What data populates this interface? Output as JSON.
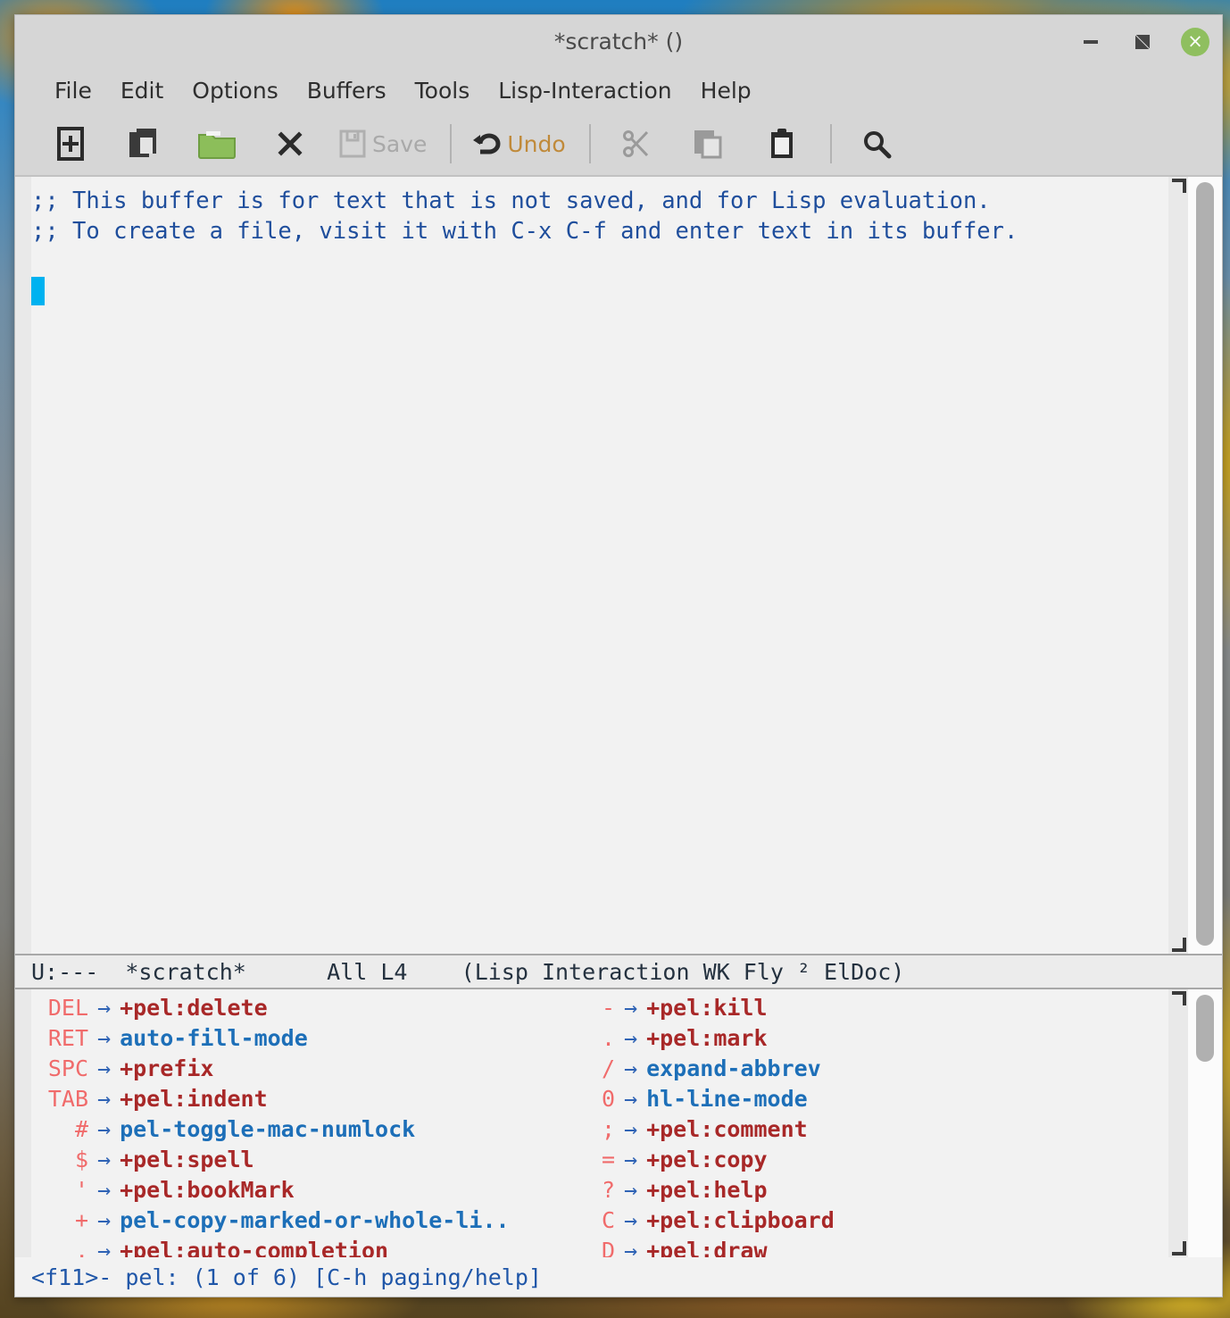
{
  "window": {
    "title": "*scratch* ()",
    "controls": {
      "minimize": "minimize",
      "maximize": "maximize",
      "close": "×"
    }
  },
  "menu_bar": {
    "items": [
      {
        "label": "File"
      },
      {
        "label": "Edit"
      },
      {
        "label": "Options"
      },
      {
        "label": "Buffers"
      },
      {
        "label": "Tools"
      },
      {
        "label": "Lisp-Interaction"
      },
      {
        "label": "Help"
      }
    ]
  },
  "tool_bar": {
    "items": [
      {
        "name": "new-file",
        "icon": "new-file-icon",
        "label": ""
      },
      {
        "name": "open-file",
        "icon": "open-file-icon",
        "label": ""
      },
      {
        "name": "open-directory",
        "icon": "folder-icon",
        "label": ""
      },
      {
        "name": "close-buffer",
        "icon": "close-x-icon",
        "label": ""
      },
      {
        "name": "save",
        "icon": "save-disk-icon",
        "label": "Save"
      },
      {
        "name": "undo",
        "icon": "undo-arrow-icon",
        "label": "Undo"
      },
      {
        "name": "cut",
        "icon": "scissors-icon",
        "label": ""
      },
      {
        "name": "copy",
        "icon": "copy-icon",
        "label": ""
      },
      {
        "name": "paste",
        "icon": "clipboard-icon",
        "label": ""
      },
      {
        "name": "search",
        "icon": "magnifier-icon",
        "label": ""
      }
    ]
  },
  "buffer": {
    "name": "*scratch*",
    "lines": [
      ";; This buffer is for text that is not saved, and for Lisp evaluation.",
      ";; To create a file, visit it with C-x C-f and enter text in its buffer.",
      "",
      ""
    ]
  },
  "mode_line": {
    "status": "U:---",
    "buffer_name": "*scratch*",
    "position": "All L4",
    "modes": "(Lisp Interaction WK Fly ² ElDoc)",
    "full": "U:---  *scratch*      All L4    (Lisp Interaction WK Fly ² ElDoc)"
  },
  "which_key": {
    "rows": [
      {
        "left": {
          "key": "DEL",
          "arrow": "→",
          "command": "+pel:delete",
          "kind": "prefix"
        },
        "right": {
          "key": "-",
          "arrow": "→",
          "command": "+pel:kill",
          "kind": "prefix"
        }
      },
      {
        "left": {
          "key": "RET",
          "arrow": "→",
          "command": "auto-fill-mode",
          "kind": "command"
        },
        "right": {
          "key": ".",
          "arrow": "→",
          "command": "+pel:mark",
          "kind": "prefix"
        }
      },
      {
        "left": {
          "key": "SPC",
          "arrow": "→",
          "command": "+prefix",
          "kind": "prefix"
        },
        "right": {
          "key": "/",
          "arrow": "→",
          "command": "expand-abbrev",
          "kind": "command"
        }
      },
      {
        "left": {
          "key": "TAB",
          "arrow": "→",
          "command": "+pel:indent",
          "kind": "prefix"
        },
        "right": {
          "key": "0",
          "arrow": "→",
          "command": "hl-line-mode",
          "kind": "command"
        }
      },
      {
        "left": {
          "key": "#",
          "arrow": "→",
          "command": "pel-toggle-mac-numlock",
          "kind": "command"
        },
        "right": {
          "key": ";",
          "arrow": "→",
          "command": "+pel:comment",
          "kind": "prefix"
        }
      },
      {
        "left": {
          "key": "$",
          "arrow": "→",
          "command": "+pel:spell",
          "kind": "prefix"
        },
        "right": {
          "key": "=",
          "arrow": "→",
          "command": "+pel:copy",
          "kind": "prefix"
        }
      },
      {
        "left": {
          "key": "'",
          "arrow": "→",
          "command": "+pel:bookMark",
          "kind": "prefix"
        },
        "right": {
          "key": "?",
          "arrow": "→",
          "command": "+pel:help",
          "kind": "prefix"
        }
      },
      {
        "left": {
          "key": "+",
          "arrow": "→",
          "command": "pel-copy-marked-or-whole-li..",
          "kind": "command"
        },
        "right": {
          "key": "C",
          "arrow": "→",
          "command": "+pel:clipboard",
          "kind": "prefix"
        }
      },
      {
        "left": {
          "key": ",",
          "arrow": "→",
          "command": "+pel:auto-completion",
          "kind": "prefix"
        },
        "right": {
          "key": "D",
          "arrow": "→",
          "command": "+pel:draw",
          "kind": "prefix"
        }
      }
    ]
  },
  "echo_line": {
    "text": "<f11>- pel: (1 of 6) [C-h paging/help]"
  },
  "colors": {
    "cursor": "#00b2f0",
    "comment_text": "#1f4e9c",
    "whichkey_key": "#f06b6b",
    "whichkey_prefix": "#a82828",
    "whichkey_command": "#1d6fb8",
    "whichkey_arrow": "#2f63b5",
    "close_button": "#8fbf5f",
    "toolbar_label": "#c08a3a",
    "folder_icon": "#8cbe5a"
  }
}
